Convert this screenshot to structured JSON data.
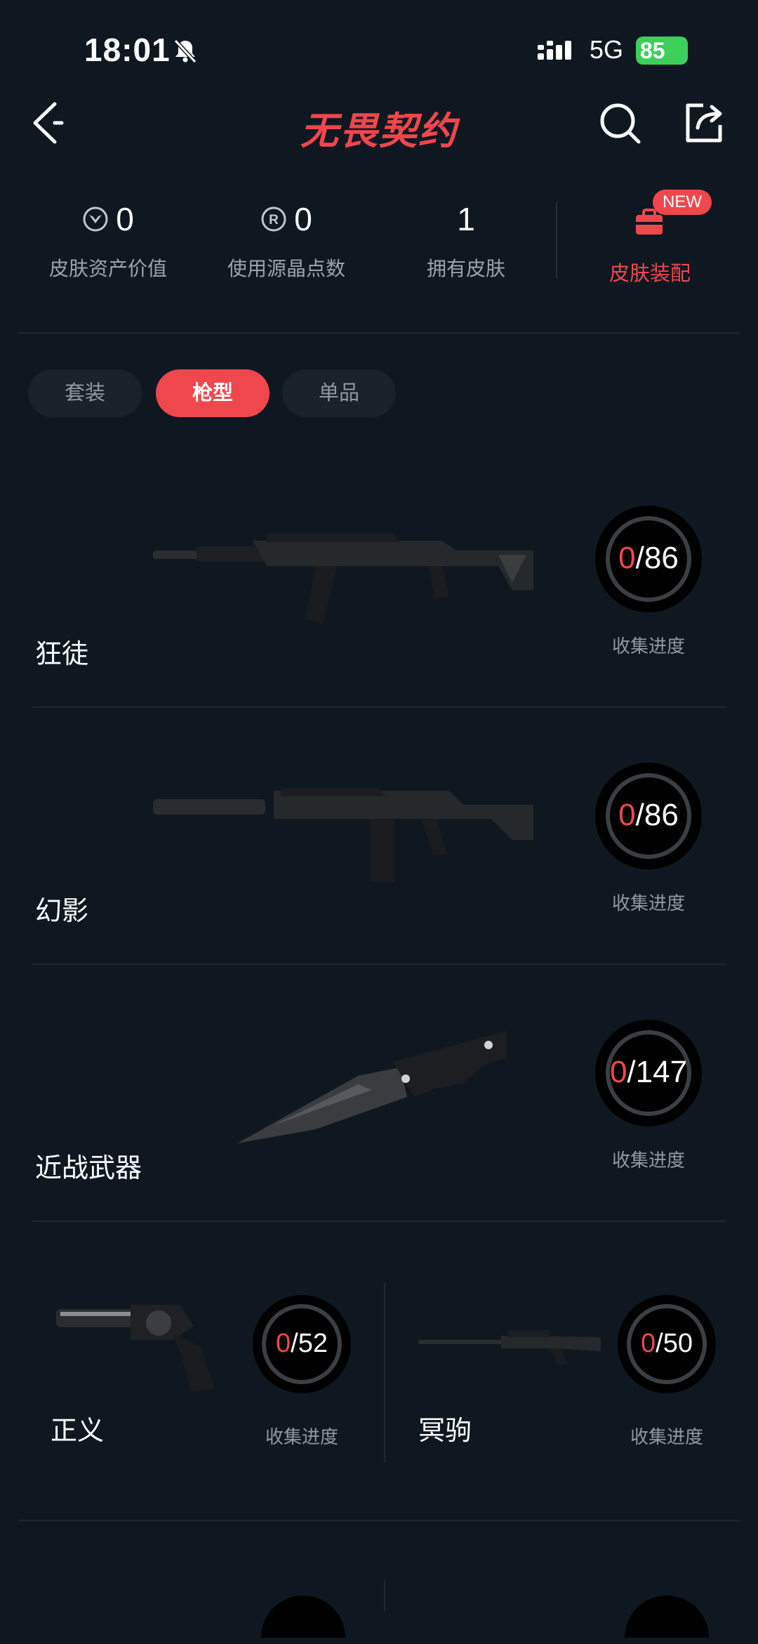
{
  "status_bar": {
    "time": "18:01",
    "network": "5G",
    "battery": "85"
  },
  "header": {
    "title": "无畏契约",
    "icons": [
      "back-icon",
      "search-icon",
      "share-icon"
    ]
  },
  "stats": [
    {
      "value": "0",
      "label": "皮肤资产价值",
      "icon": "valorant-points-icon"
    },
    {
      "value": "0",
      "label": "使用源晶点数",
      "icon": "radianite-icon"
    },
    {
      "value": "1",
      "label": "拥有皮肤"
    }
  ],
  "equip": {
    "label": "皮肤装配",
    "badge": "NEW",
    "icon": "backpack-icon"
  },
  "tabs": [
    {
      "label": "套装",
      "active": false
    },
    {
      "label": "枪型",
      "active": true
    },
    {
      "label": "单品",
      "active": false
    }
  ],
  "weapons": [
    {
      "name": "狂徒",
      "owned": "0",
      "total": "/86",
      "progress_label": "收集进度"
    },
    {
      "name": "幻影",
      "owned": "0",
      "total": "/86",
      "progress_label": "收集进度"
    },
    {
      "name": "近战武器",
      "owned": "0",
      "total": "/147",
      "progress_label": "收集进度"
    },
    {
      "name": "正义",
      "owned": "0",
      "total": "/52",
      "progress_label": "收集进度"
    },
    {
      "name": "冥驹",
      "owned": "0",
      "total": "/50",
      "progress_label": "收集进度"
    }
  ],
  "colors": {
    "accent": "#f0474c",
    "background": "#0f1821",
    "ring": "#3a3f44"
  }
}
